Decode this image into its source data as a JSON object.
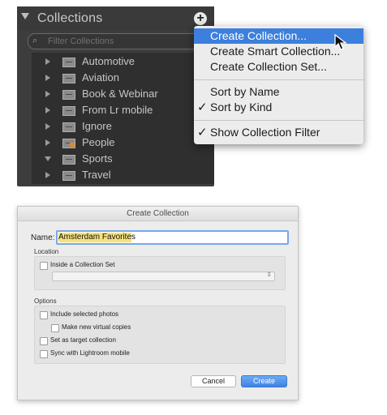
{
  "panel": {
    "title": "Collections",
    "add_label": "+",
    "filter_placeholder": "Filter Collections",
    "items": [
      {
        "label": "Automotive",
        "expanded": false
      },
      {
        "label": "Aviation",
        "expanded": false
      },
      {
        "label": "Book & Webinar",
        "expanded": false
      },
      {
        "label": "From Lr mobile",
        "expanded": false
      },
      {
        "label": "Ignore",
        "expanded": false
      },
      {
        "label": "People",
        "expanded": false
      },
      {
        "label": "Sports",
        "expanded": true
      },
      {
        "label": "Travel",
        "expanded": false
      }
    ]
  },
  "menu": {
    "items": [
      {
        "label": "Create Collection...",
        "highlighted": true
      },
      {
        "label": "Create Smart Collection..."
      },
      {
        "label": "Create Collection Set..."
      },
      {
        "label": "Sort by Name"
      },
      {
        "label": "Sort by Kind",
        "checked": true
      },
      {
        "label": "Show Collection Filter",
        "checked": true
      }
    ],
    "check_glyph": "✓",
    "highlight_color": "#3d7fdc"
  },
  "dialog": {
    "title": "Create Collection",
    "name_label": "Name:",
    "name_value": "Amsterdam Favorites",
    "location_label": "Location",
    "inside_set_label": "Inside a Collection Set",
    "options_label": "Options",
    "include_selected_label": "Include selected photos",
    "virtual_copies_label": "Make new virtual copies",
    "target_label": "Set as target collection",
    "sync_label": "Sync with Lightroom mobile",
    "cancel_label": "Cancel",
    "create_label": "Create",
    "accent_color": "#3e84e4"
  }
}
